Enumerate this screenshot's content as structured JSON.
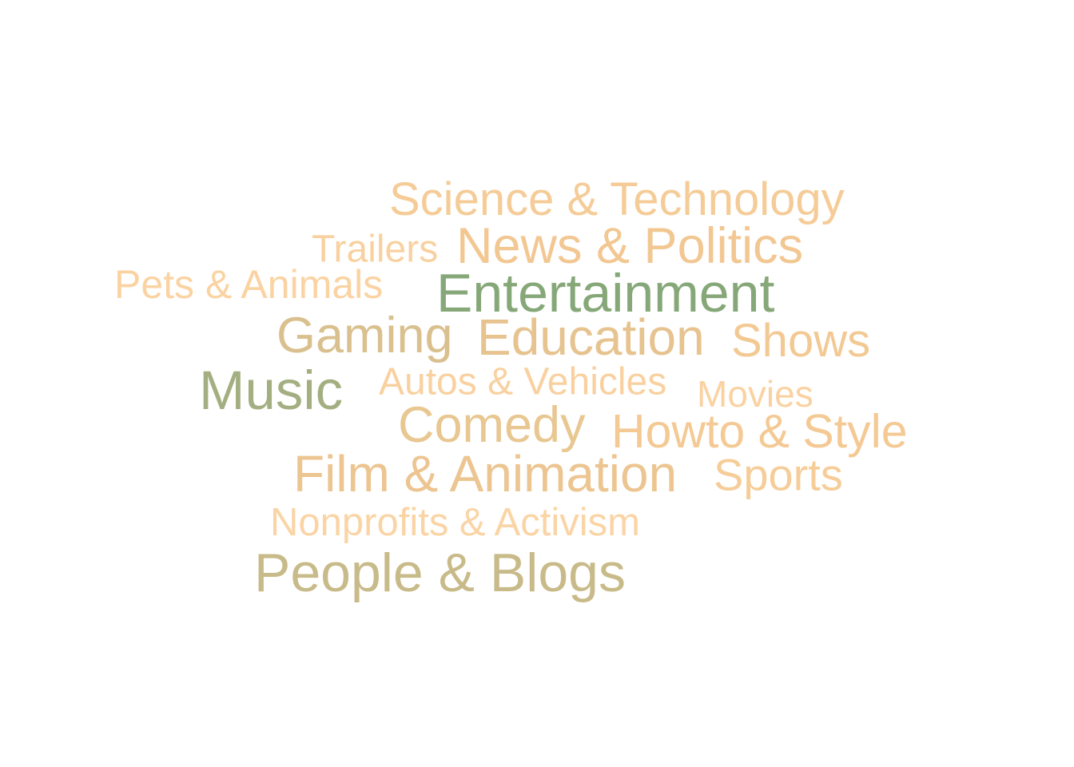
{
  "words": [
    {
      "text": "Science & Technology",
      "color": "#f5cc97"
    },
    {
      "text": "Trailers",
      "color": "#f9d1a0"
    },
    {
      "text": "News & Politics",
      "color": "#f2c792"
    },
    {
      "text": "Pets & Animals",
      "color": "#fbd3a2"
    },
    {
      "text": "Entertainment",
      "color": "#86a879"
    },
    {
      "text": "Gaming",
      "color": "#d9c08e"
    },
    {
      "text": "Education",
      "color": "#e6c38f"
    },
    {
      "text": "Shows",
      "color": "#f3c993"
    },
    {
      "text": "Music",
      "color": "#a4af81"
    },
    {
      "text": "Autos & Vehicles",
      "color": "#f9d1a0"
    },
    {
      "text": "Movies",
      "color": "#fad2a2"
    },
    {
      "text": "Comedy",
      "color": "#e8c791"
    },
    {
      "text": "Howto & Style",
      "color": "#f4c994"
    },
    {
      "text": "Film & Animation",
      "color": "#ecc591"
    },
    {
      "text": "Sports",
      "color": "#f6cd98"
    },
    {
      "text": "Nonprofits & Activism",
      "color": "#fbd4a5"
    },
    {
      "text": "People & Blogs",
      "color": "#c8bb89"
    }
  ]
}
